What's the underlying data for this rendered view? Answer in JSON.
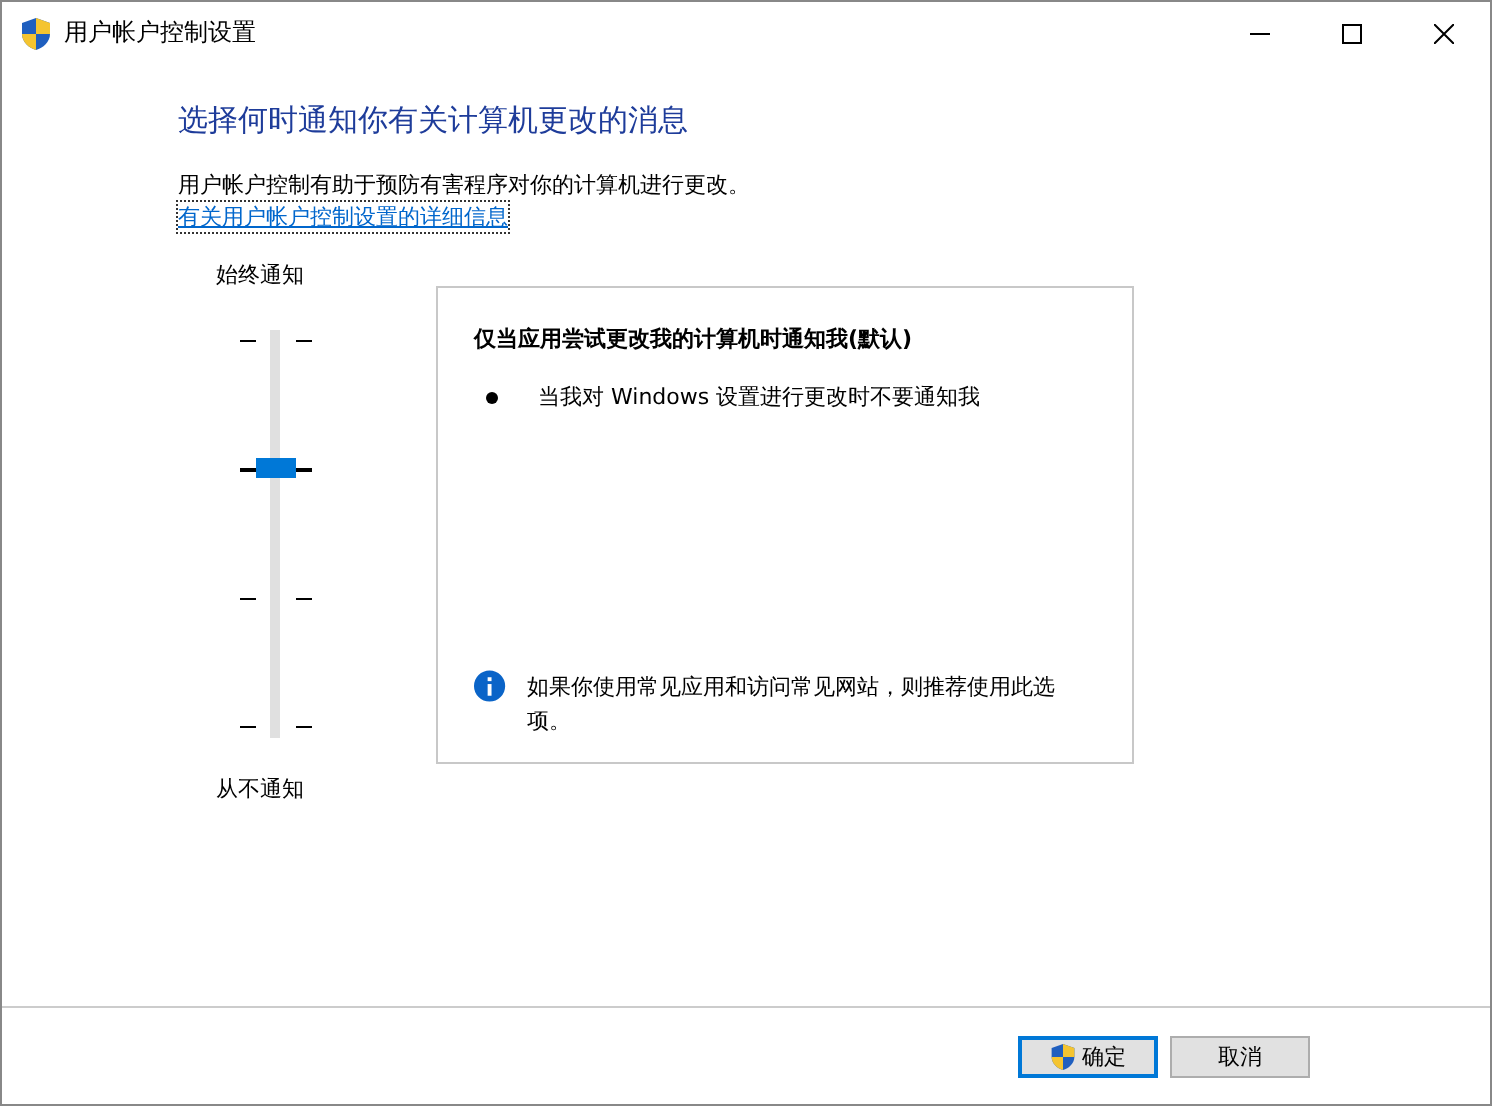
{
  "window": {
    "title": "用户帐户控制设置"
  },
  "heading": "选择何时通知你有关计算机更改的消息",
  "description": "用户帐户控制有助于预防有害程序对你的计算机进行更改。",
  "link": "有关用户帐户控制设置的详细信息",
  "slider": {
    "top_label": "始终通知",
    "bottom_label": "从不通知",
    "level": 0.667
  },
  "info_panel": {
    "title": "仅当应用尝试更改我的计算机时通知我(默认)",
    "bullets": [
      "当我对 Windows 设置进行更改时不要通知我"
    ],
    "note": "如果你使用常见应用和访问常见网站，则推荐使用此选项。"
  },
  "buttons": [
    {
      "label": "确定",
      "kind": "shield",
      "selected": true
    },
    {
      "label": "取消",
      "kind": "plain",
      "selected": false
    }
  ]
}
